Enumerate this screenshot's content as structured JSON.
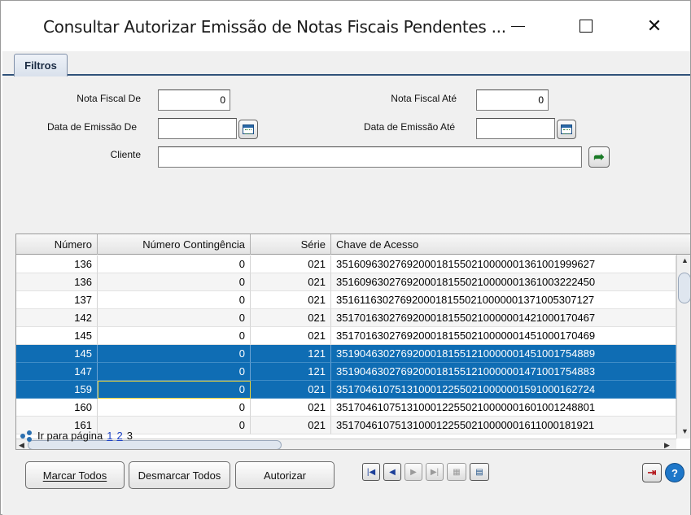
{
  "window": {
    "title": "Consultar Autorizar Emissão de Notas Fiscais Pendentes ..."
  },
  "tabs": [
    {
      "label": "Filtros"
    }
  ],
  "filters": {
    "nota_fiscal_de_label": "Nota Fiscal De",
    "nota_fiscal_de_value": "0",
    "nota_fiscal_ate_label": "Nota Fiscal Até",
    "nota_fiscal_ate_value": "0",
    "data_emissao_de_label": "Data de Emissão De",
    "data_emissao_de_value": "",
    "data_emissao_ate_label": "Data de Emissão Até",
    "data_emissao_ate_value": "",
    "cliente_label": "Cliente",
    "cliente_value": ""
  },
  "grid": {
    "columns": [
      "Número",
      "Número Contingência",
      "Série",
      "Chave de Acesso"
    ],
    "rows": [
      {
        "numero": "136",
        "contingencia": "0",
        "serie": "021",
        "chave": "35160963027692000181550210000001361001999627",
        "selected": false
      },
      {
        "numero": "136",
        "contingencia": "0",
        "serie": "021",
        "chave": "35160963027692000181550210000001361003222450",
        "selected": false
      },
      {
        "numero": "137",
        "contingencia": "0",
        "serie": "021",
        "chave": "35161163027692000181550210000001371005307127",
        "selected": false
      },
      {
        "numero": "142",
        "contingencia": "0",
        "serie": "021",
        "chave": "35170163027692000181550210000001421000170467",
        "selected": false
      },
      {
        "numero": "145",
        "contingencia": "0",
        "serie": "021",
        "chave": "35170163027692000181550210000001451000170469",
        "selected": false
      },
      {
        "numero": "145",
        "contingencia": "0",
        "serie": "121",
        "chave": "35190463027692000181551210000001451001754889",
        "selected": true
      },
      {
        "numero": "147",
        "contingencia": "0",
        "serie": "121",
        "chave": "35190463027692000181551210000001471001754883",
        "selected": true
      },
      {
        "numero": "159",
        "contingencia": "0",
        "serie": "021",
        "chave": "35170461075131000122550210000001591000162724",
        "selected": true
      },
      {
        "numero": "160",
        "contingencia": "0",
        "serie": "021",
        "chave": "35170461075131000122550210000001601001248801",
        "selected": false
      },
      {
        "numero": "161",
        "contingencia": "0",
        "serie": "021",
        "chave": "35170461075131000122550210000001611000181921",
        "selected": false
      }
    ]
  },
  "pager": {
    "label": "Ir para página",
    "pages": [
      "1",
      "2",
      "3"
    ],
    "current": "3"
  },
  "buttons": {
    "marcar_todos": "Marcar Todos",
    "desmarcar_todos": "Desmarcar Todos",
    "autorizar": "Autorizar"
  },
  "nav_icons": [
    "first-page-icon",
    "prev-page-icon",
    "next-page-icon",
    "last-page-icon",
    "grid-view-icon",
    "export-icon"
  ],
  "colors": {
    "selection": "#0f6db4",
    "tab_border": "#30527a",
    "link": "#1a3fc4"
  }
}
